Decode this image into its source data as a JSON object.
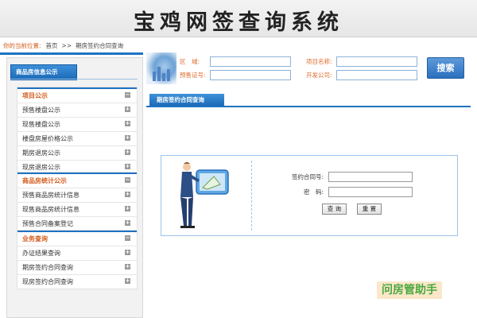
{
  "header": {
    "title": "宝鸡网签查询系统"
  },
  "breadcrumb": {
    "label": "你的当前位置:",
    "home": "首页",
    "separator": ">>",
    "current": "期房签约合同查询"
  },
  "sidebar": {
    "header": "商品房信息公示",
    "sections": [
      {
        "title": "项目公示",
        "items": [
          "预售楼盘公示",
          "现售楼盘公示",
          "楼盘房屋价格公示",
          "期房退房公示",
          "现房退房公示"
        ]
      },
      {
        "title": "商品房统计公示",
        "items": [
          "预售商品房统计信息",
          "现售商品房统计信息",
          "预售合同备案登记"
        ]
      },
      {
        "title": "业务查询",
        "items": [
          "办证结果查询",
          "期房签约合同查询",
          "现房签约合同查询"
        ]
      }
    ]
  },
  "search": {
    "district_label": "区　域:",
    "presale_label": "预售证号:",
    "project_label": "项目名称:",
    "developer_label": "开发公司:",
    "button": "搜索"
  },
  "main": {
    "tab": "期房签约合同查询",
    "contract_label": "签约合同号:",
    "password_label": "密　码:",
    "query_button": "查 询",
    "reset_button": "重 置"
  },
  "watermark": "问房管助手",
  "colors": {
    "accent": "#1e73c2",
    "orange": "#d35b1b",
    "button_blue": "#2b6fbf"
  }
}
